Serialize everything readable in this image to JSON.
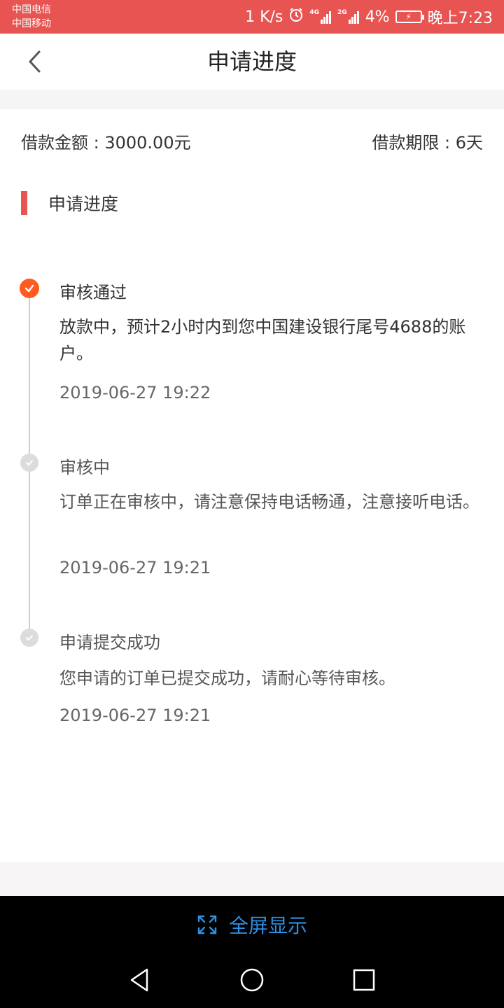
{
  "status_bar": {
    "carrier_1": "中国电信",
    "carrier_2": "中国移动",
    "speed": "1 K/s",
    "net_1": "4G",
    "net_2": "2G",
    "battery": "4%",
    "time": "晚上7:23"
  },
  "header": {
    "title": "申请进度"
  },
  "summary": {
    "amount": "借款金额 : 3000.00元",
    "term": "借款期限 : 6天"
  },
  "section": {
    "title": "申请进度"
  },
  "steps": [
    {
      "title": "审核通过",
      "desc": "放款中，预计2小时内到您中国建设银行尾号4688的账户。",
      "time": "2019-06-27 19:22",
      "status": "active"
    },
    {
      "title": "审核中",
      "desc": "订单正在审核中，请注意保持电话畅通，注意接听电话。",
      "time": "2019-06-27 19:21",
      "status": "done"
    },
    {
      "title": "申请提交成功",
      "desc": "您申请的订单已提交成功，请耐心等待审核。",
      "time": "2019-06-27 19:21",
      "status": "done"
    }
  ],
  "fullscreen": {
    "label": "全屏显示"
  },
  "colors": {
    "accent": "#e85452",
    "active_dot": "#ff5a1f",
    "link_blue": "#2f8fe0"
  }
}
